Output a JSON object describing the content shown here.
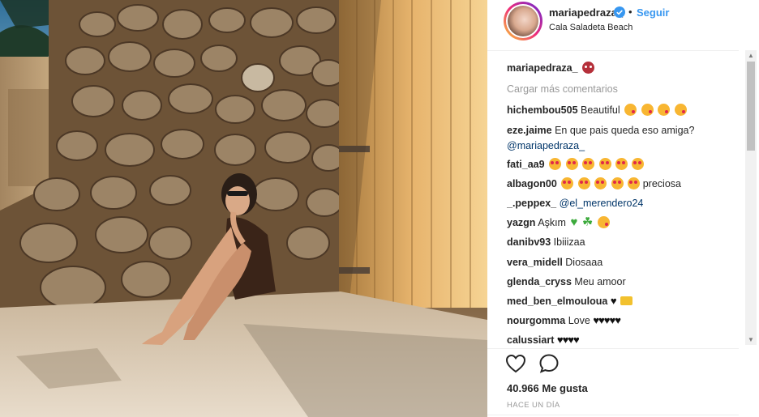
{
  "post": {
    "username": "mariapedraza_",
    "follow_label": "Seguir",
    "location": "Cala Saladeta Beach",
    "separator": "•"
  },
  "caption": {
    "username": "mariapedraza_"
  },
  "load_more": "Cargar más comentarios",
  "comments": [
    {
      "user": "hichembou505",
      "text": "Beautiful"
    },
    {
      "user": "eze.jaime",
      "text": "En que pais queda eso amiga?",
      "mention": "@mariapedraza_"
    },
    {
      "user": "fati_aa9",
      "text": ""
    },
    {
      "user": "albagon00",
      "text": "preciosa"
    },
    {
      "user": "_.peppex_",
      "mention": "@el_merendero24"
    },
    {
      "user": "yazgn",
      "text": "Aşkım"
    },
    {
      "user": "danibv93",
      "text": "Ibiiizaa"
    },
    {
      "user": "vera_midell",
      "text": "Diosaaa"
    },
    {
      "user": "glenda_cryss",
      "text": "Meu amoor"
    },
    {
      "user": "med_ben_elmouloua",
      "text": ""
    },
    {
      "user": "nourgomma",
      "text": "Love"
    },
    {
      "user": "calussiart",
      "text": ""
    }
  ],
  "likes": "40.966 Me gusta",
  "timestamp": "HACE UN DÍA",
  "icons": {
    "verified": "verified-badge-icon",
    "like": "heart-outline-icon",
    "comment": "speech-bubble-icon"
  },
  "colors": {
    "link": "#3897f0",
    "mention": "#003569",
    "muted": "#999999",
    "text": "#262626"
  }
}
